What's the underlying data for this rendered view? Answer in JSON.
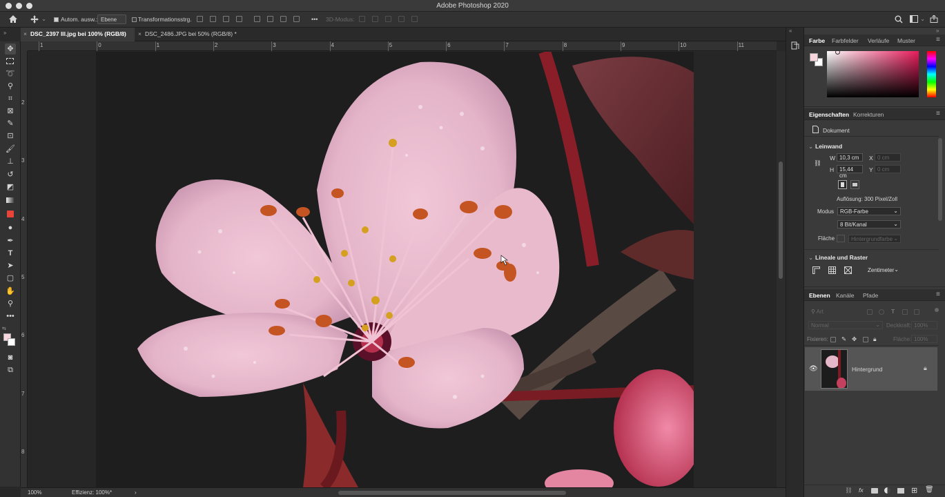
{
  "window": {
    "title": "Adobe Photoshop 2020"
  },
  "options_bar": {
    "auto_select_label": "Autom. ausw.:",
    "auto_select_value": "Ebene",
    "transform_controls_label": "Transformationsstrg.",
    "more_label": "•••",
    "mode_3d_label": "3D-Modus:"
  },
  "tabs": [
    {
      "label": "DSC_2397 lll.jpg bei 100% (RGB/8)"
    },
    {
      "label": "DSC_2486.JPG bei 50% (RGB/8) *"
    }
  ],
  "ruler": {
    "top": [
      "1",
      "0",
      "1",
      "2",
      "3",
      "4",
      "5",
      "6",
      "7",
      "8",
      "9",
      "10",
      "11"
    ],
    "left": [
      "2",
      "3",
      "4",
      "5",
      "6",
      "7",
      "8"
    ]
  },
  "status": {
    "zoom": "100%",
    "efficiency": "Effizienz: 100%*",
    "arrow": "›"
  },
  "color_panel": {
    "tabs": [
      "Farbe",
      "Farbfelder",
      "Verläufe",
      "Muster"
    ],
    "foreground": "#f6d5dc",
    "background": "#ffffff"
  },
  "properties": {
    "tabs": [
      "Eigenschaften",
      "Korrekturen"
    ],
    "doc_label": "Dokument",
    "canvas_title": "Leinwand",
    "w_label": "W",
    "w_value": "10,3 cm",
    "h_label": "H",
    "h_value": "15,44 cm",
    "x_label": "X",
    "x_value": "0 cm",
    "y_label": "Y",
    "y_value": "0 cm",
    "resolution": "Auflösung: 300 Pixel/Zoll",
    "mode_label": "Modus",
    "mode_value": "RGB-Farbe",
    "bits_value": "8 Bit/Kanal",
    "fill_label": "Fläche",
    "fill_value": "Hintergrundfarbe",
    "rulers_title": "Lineale und Raster",
    "unit_value": "Zentimeter"
  },
  "layers": {
    "tabs": [
      "Ebenen",
      "Kanäle",
      "Pfade"
    ],
    "filter_placeholder": "Art",
    "blend_mode": "Normal",
    "opacity_label": "Deckkraft:",
    "opacity_value": "100%",
    "lock_label": "Fixieren:",
    "fill_label": "Fläche:",
    "fill_value": "100%",
    "items": [
      {
        "name": "Hintergrund"
      }
    ]
  },
  "icons": {
    "app": "home-icon",
    "move": "move-icon"
  }
}
